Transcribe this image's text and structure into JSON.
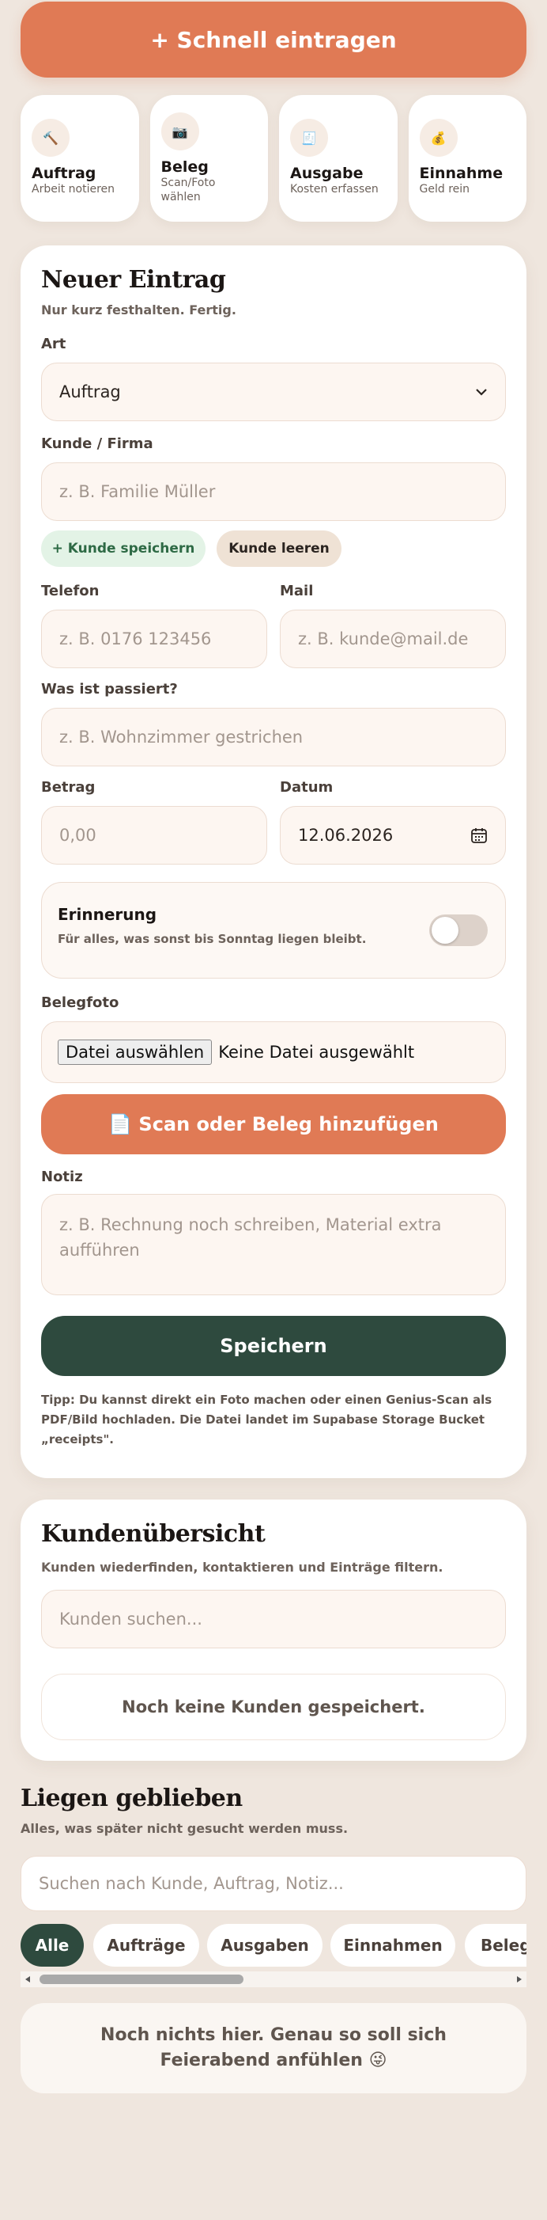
{
  "quick_add": {
    "label": "+ Schnell eintragen"
  },
  "quick_cards": [
    {
      "icon": "hammer-icon",
      "glyph": "🔨",
      "title": "Auftrag",
      "subtitle": "Arbeit notieren"
    },
    {
      "icon": "camera-icon",
      "glyph": "📷",
      "title": "Beleg",
      "subtitle": "Scan/Foto wählen"
    },
    {
      "icon": "receipt-icon",
      "glyph": "🧾",
      "title": "Ausgabe",
      "subtitle": "Kosten erfassen"
    },
    {
      "icon": "moneybag-icon",
      "glyph": "💰",
      "title": "Einnahme",
      "subtitle": "Geld rein"
    }
  ],
  "entry": {
    "title": "Neuer Eintrag",
    "subtitle": "Nur kurz festhalten. Fertig.",
    "type_label": "Art",
    "type_value": "Auftrag",
    "customer_label": "Kunde / Firma",
    "customer_placeholder": "z. B. Familie Müller",
    "save_customer": "+ Kunde speichern",
    "clear_customer": "Kunde leeren",
    "phone_label": "Telefon",
    "phone_placeholder": "z. B. 0176 123456",
    "mail_label": "Mail",
    "mail_placeholder": "z. B. kunde@mail.de",
    "what_label": "Was ist passiert?",
    "what_placeholder": "z. B. Wohnzimmer gestrichen",
    "amount_label": "Betrag",
    "amount_placeholder": "0,00",
    "date_label": "Datum",
    "date_value": "12.06.2026",
    "reminder_title": "Erinnerung",
    "reminder_text": "Für alles, was sonst bis Sonntag liegen bleibt.",
    "reminder_on": false,
    "photo_label": "Belegfoto",
    "file_button": "Datei auswählen",
    "file_status": "Keine Datei ausgewählt",
    "scan_button": "📄 Scan oder Beleg hinzufügen",
    "note_label": "Notiz",
    "note_placeholder": "z. B. Rechnung noch schreiben, Material extra aufführen",
    "save_button": "Speichern",
    "tip": "Tipp: Du kannst direkt ein Foto machen oder einen Genius-Scan als PDF/Bild hochladen. Die Datei landet im Supabase Storage Bucket „receipts\"."
  },
  "customers": {
    "title": "Kundenübersicht",
    "subtitle": "Kunden wiederfinden, kontaktieren und Einträge filtern.",
    "search_placeholder": "Kunden suchen...",
    "empty": "Noch keine Kunden gespeichert."
  },
  "backlog": {
    "title": "Liegen geblieben",
    "subtitle": "Alles, was später nicht gesucht werden muss.",
    "search_placeholder": "Suchen nach Kunde, Auftrag, Notiz...",
    "filters": [
      "Alle",
      "Aufträge",
      "Ausgaben",
      "Einnahmen",
      "Belege"
    ],
    "active_filter": "Alle",
    "empty": "Noch nichts hier. Genau so soll sich Feierabend anfühlen 😜"
  },
  "colors": {
    "accent": "#e07a55",
    "dark_green": "#2e4a3e",
    "background": "#efe6de"
  }
}
